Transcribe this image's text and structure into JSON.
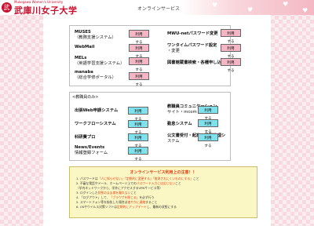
{
  "header": {
    "university_en": "Mukogawa Women's University",
    "university_ja": "武庫川女子大学",
    "logo_mark": "武",
    "title": "オンラインサービス"
  },
  "services_top": [
    {
      "title": "MUSES",
      "subtitle": "（教務支援システム）",
      "button": "利用する"
    },
    {
      "title": "WebMail",
      "subtitle": "",
      "button": "利用する"
    },
    {
      "title": "MELs",
      "subtitle": "（英語学習支援システム）",
      "button": "利用する"
    },
    {
      "title": "manaba",
      "subtitle": "（総合学修ポータル）",
      "button": "利用する"
    },
    {
      "title": "MWU-netパスワード変更",
      "subtitle": "",
      "button": "利用する"
    },
    {
      "title": "ワンタイムパスワード設定",
      "subtitle": "・変更",
      "button": "利用する"
    },
    {
      "title": "図書館蔵書検索・各種申し込み",
      "subtitle": "",
      "button": "利用する"
    }
  ],
  "staff_section": {
    "title": "<教職員のみ>",
    "items": [
      {
        "title": "出張Web申請システム",
        "subtitle": "",
        "button": "利用する"
      },
      {
        "title": "ワークフローシステム",
        "subtitle": "",
        "button": "利用する"
      },
      {
        "title": "科研費プロ",
        "subtitle": "",
        "button": "利用する"
      },
      {
        "title": "News/Events",
        "subtitle": "情報登録フォーム",
        "button": "利用する"
      },
      {
        "title": "教職員コミュニケーション",
        "subtitle": "サイト・mcom",
        "button": "利用する"
      },
      {
        "title": "勤怠システム",
        "subtitle": "",
        "button": "利用する"
      },
      {
        "title": "公文書受付・起案・鑑製管理シ",
        "subtitle": "ステム",
        "button": "利用する"
      }
    ]
  },
  "notice": {
    "title": "オンラインサービス利用上の注意！！",
    "lines": [
      {
        "prefix": "1. パスワードは",
        "highlight": "「人に知らせない」「定期的に変更する」「推測されにくいものにする」",
        "suffix": "こと"
      },
      {
        "prefix": "2. 不審な電話やメール、ホームページ上での",
        "highlight": "パスワード入力には応じない",
        "suffix": "こと"
      },
      {
        "prefix": "    （学内ネットワークから、学外にアクセスするVPNサービス等）",
        "highlight": "",
        "suffix": ""
      },
      {
        "prefix": "3. ログインした",
        "highlight": "状態のまま席を離れない",
        "suffix": "こと"
      },
      {
        "prefix": "4. 「ログアウト」して、",
        "highlight": "「ブラウザを閉じる」",
        "suffix": "を必ず行う"
      },
      {
        "prefix": "5. スマートフォン等を紛失した場合は",
        "highlight": "速やかに連絡",
        "suffix": "すること"
      },
      {
        "prefix": "6. OSやウイルス対策ソフトは",
        "highlight": "定期的にアップデート",
        "suffix": "し、最新の状態にする"
      }
    ]
  },
  "colors": {
    "button_pink": "#f4b6c4",
    "button_teal": "#7fe1ec",
    "notice_bg": "#fbf7c4",
    "brand_red": "#c8102e"
  }
}
